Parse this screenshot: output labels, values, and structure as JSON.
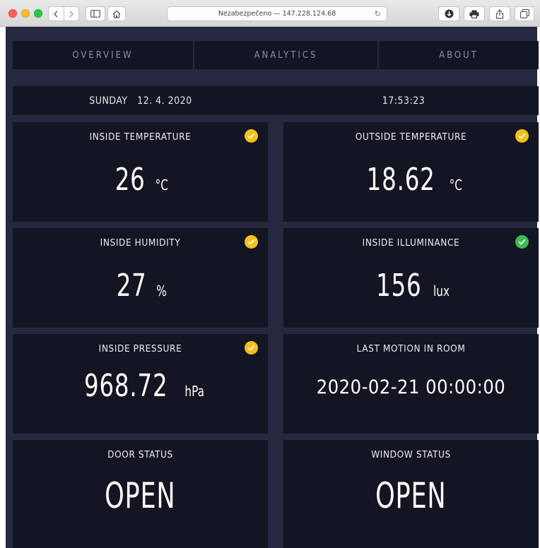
{
  "browser": {
    "address": "Nezabezpečeno — 147.228.124.68"
  },
  "nav": {
    "tabs": [
      {
        "label": "OVERVIEW"
      },
      {
        "label": "ANALYTICS"
      },
      {
        "label": "ABOUT"
      }
    ]
  },
  "datetime": {
    "date": "SUNDAY   12. 4. 2020",
    "time": "17:53:23"
  },
  "cards": {
    "inside_temperature": {
      "title": "INSIDE TEMPERATURE",
      "value": "26",
      "unit": "°C",
      "status": "warning"
    },
    "outside_temperature": {
      "title": "OUTSIDE TEMPERATURE",
      "value": "18.62",
      "unit": "°C",
      "status": "warning"
    },
    "inside_humidity": {
      "title": "INSIDE HUMIDITY",
      "value": "27",
      "unit": "%",
      "status": "warning"
    },
    "inside_illuminance": {
      "title": "INSIDE ILLUMINANCE",
      "value": "156",
      "unit": "lux",
      "status": "ok"
    },
    "inside_pressure": {
      "title": "INSIDE PRESSURE",
      "value": "968.72",
      "unit": "hPa",
      "status": "warning"
    },
    "last_motion": {
      "title": "LAST MOTION IN ROOM",
      "value": "2020-02-21 00:00:00"
    },
    "door_status": {
      "title": "DOOR STATUS",
      "value": "OPEN"
    },
    "window_status": {
      "title": "WINDOW STATUS",
      "value": "OPEN"
    }
  },
  "colors": {
    "background": "#262840",
    "panel": "#141522",
    "status_warning": "#f3c11a",
    "status_ok": "#3fb94f"
  }
}
